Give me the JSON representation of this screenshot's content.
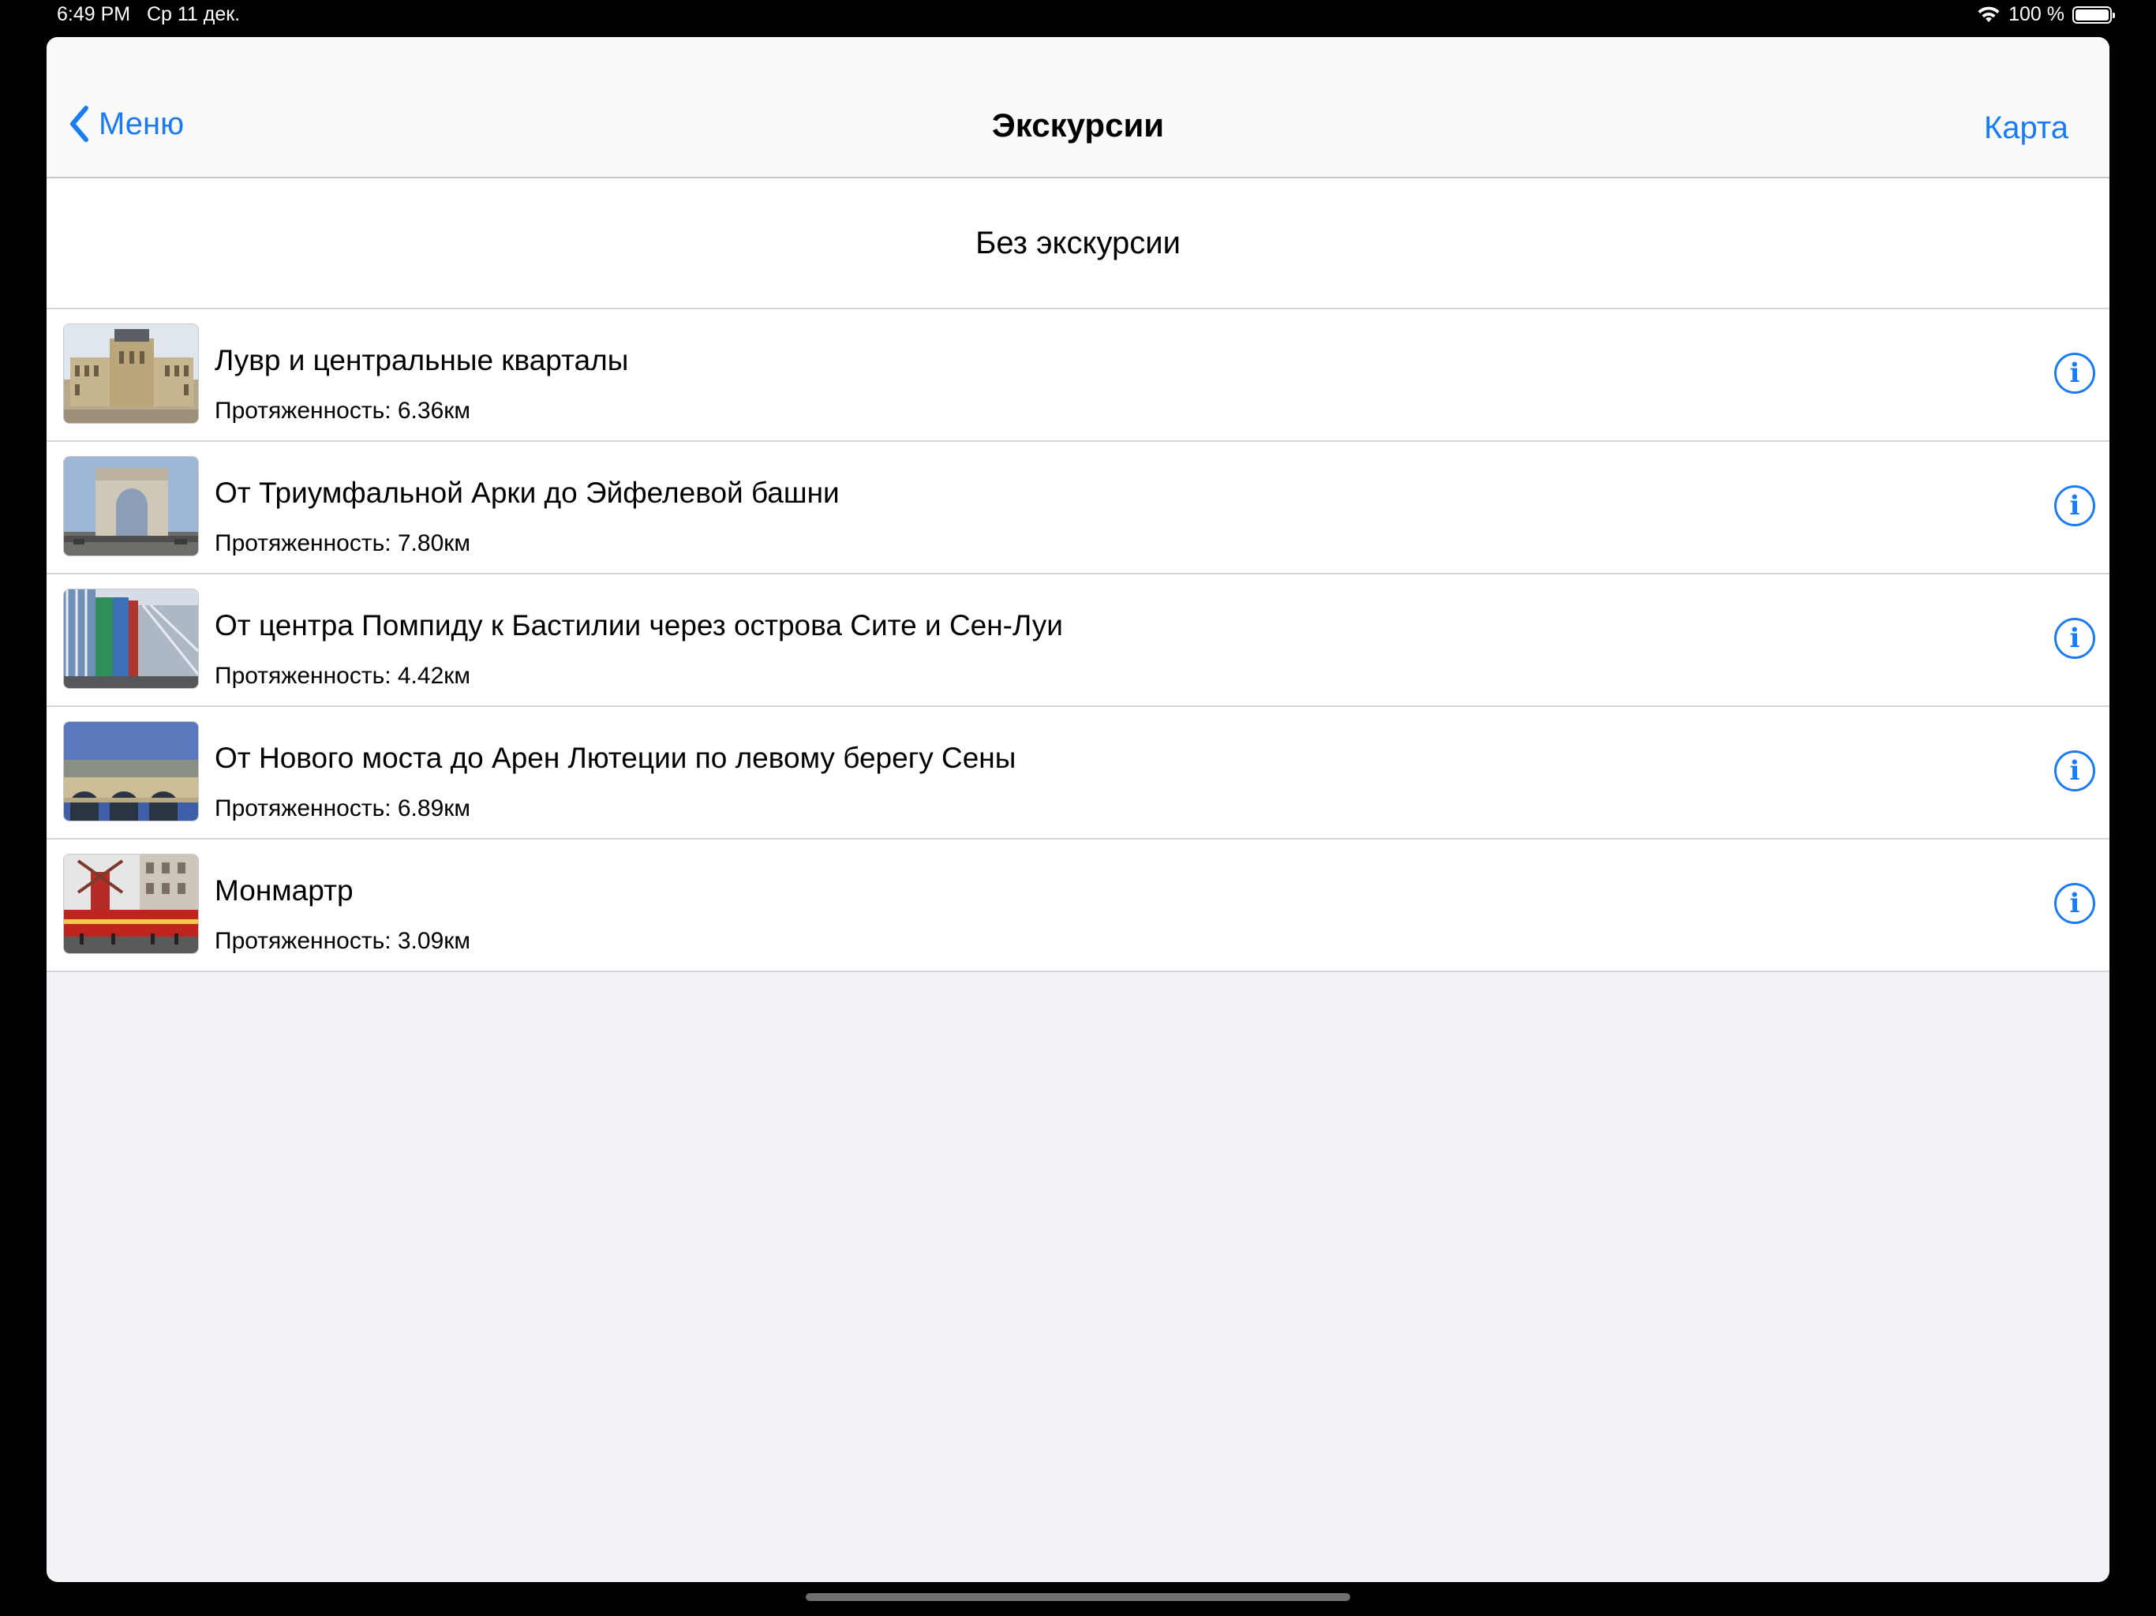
{
  "status_bar": {
    "time": "6:49 PM",
    "date": "Ср 11 дек.",
    "battery": "100 %",
    "icons": [
      "wifi-icon",
      "battery-icon"
    ]
  },
  "navbar": {
    "back_label": "Меню",
    "title": "Экскурсии",
    "right_button": "Карта",
    "accent_color": "#1a7cf5"
  },
  "no_tour": "Без экскурсии",
  "tours": [
    {
      "title": "Лувр и центральные кварталы",
      "length": "Протяженность: 6.36км",
      "image": "louvre"
    },
    {
      "title": "От Триумфальной Арки до Эйфелевой башни",
      "length": "Протяженность: 7.80км",
      "image": "arc-de-triomphe"
    },
    {
      "title": "От центра Помпиду к Бастилии через острова Сите и Сен-Луи",
      "length": "Протяженность: 4.42км",
      "image": "centre-pompidou"
    },
    {
      "title": "От Нового моста до Арен Лютеции по левому берегу Сены",
      "length": "Протяженность: 6.89км",
      "image": "pont-neuf"
    },
    {
      "title": "Монмартр",
      "length": "Протяженность: 3.09км",
      "image": "moulin-rouge"
    }
  ],
  "info_icon": "i"
}
